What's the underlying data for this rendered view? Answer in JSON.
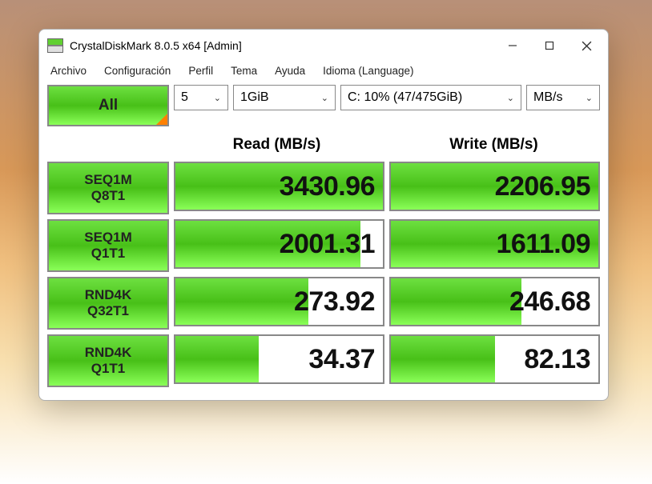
{
  "title": "CrystalDiskMark 8.0.5 x64 [Admin]",
  "menu": {
    "file": "Archivo",
    "config": "Configuración",
    "profile": "Perfil",
    "theme": "Tema",
    "help": "Ayuda",
    "language": "Idioma (Language)"
  },
  "controls": {
    "all": "All",
    "count": "5",
    "size": "1GiB",
    "disk": "C: 10% (47/475GiB)",
    "unit": "MB/s"
  },
  "headers": {
    "read": "Read (MB/s)",
    "write": "Write (MB/s)"
  },
  "rows": [
    {
      "label1": "SEQ1M",
      "label2": "Q8T1",
      "read": "3430.96",
      "readPct": 100,
      "write": "2206.95",
      "writePct": 100
    },
    {
      "label1": "SEQ1M",
      "label2": "Q1T1",
      "read": "2001.31",
      "readPct": 89,
      "write": "1611.09",
      "writePct": 100
    },
    {
      "label1": "RND4K",
      "label2": "Q32T1",
      "read": "273.92",
      "readPct": 64,
      "write": "246.68",
      "writePct": 63
    },
    {
      "label1": "RND4K",
      "label2": "Q1T1",
      "read": "34.37",
      "readPct": 40,
      "write": "82.13",
      "writePct": 50
    }
  ]
}
